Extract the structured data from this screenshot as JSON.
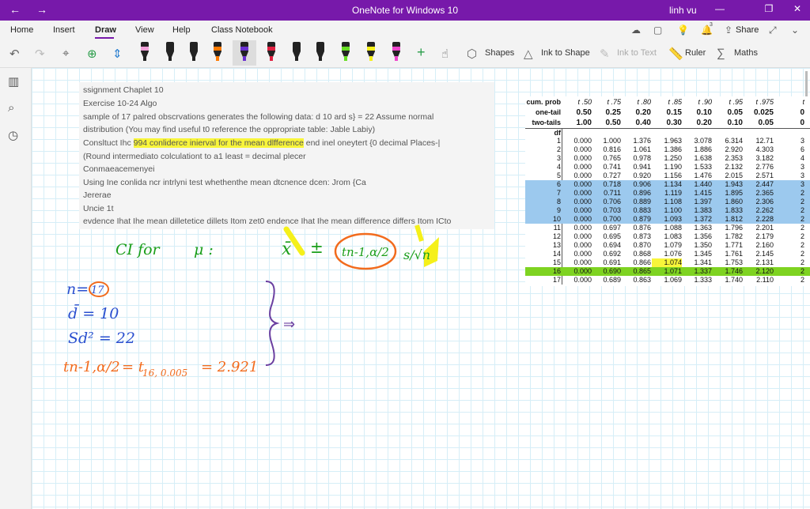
{
  "window": {
    "title": "OneNote for Windows 10",
    "user": "linh vu"
  },
  "ribbon": {
    "tabs": [
      "Home",
      "Insert",
      "Draw",
      "View",
      "Help",
      "Class Notebook"
    ],
    "active_tab": "Draw",
    "notification_count": "3",
    "share_label": "Share"
  },
  "toolbar": {
    "shapes_label": "Shapes",
    "ink_to_shape_label": "Ink to Shape",
    "ink_to_text_label": "Ink to Text",
    "ruler_label": "Ruler",
    "maths_label": "Maths",
    "pens": [
      {
        "name": "pen-purple-band",
        "band": "#f0a0d8",
        "tip": "#222"
      },
      {
        "name": "pen-black-1",
        "band": "#222",
        "tip": "#222"
      },
      {
        "name": "pen-black-2",
        "band": "#222",
        "tip": "#222"
      },
      {
        "name": "pen-orange",
        "band": "#ff7a00",
        "tip": "#ff7a00"
      },
      {
        "name": "pen-purple",
        "band": "#6a2fd0",
        "tip": "#6a2fd0"
      },
      {
        "name": "pen-red",
        "band": "#e02040",
        "tip": "#e02040"
      },
      {
        "name": "pen-black-3",
        "band": "#222",
        "tip": "#222"
      },
      {
        "name": "pen-black-4",
        "band": "#222",
        "tip": "#222"
      },
      {
        "name": "highlighter-green",
        "band": "#66dd22",
        "tip": "#66dd22"
      },
      {
        "name": "highlighter-yellow",
        "band": "#f5f01a",
        "tip": "#f5f01a"
      },
      {
        "name": "highlighter-pink",
        "band": "#ee44cc",
        "tip": "#ee44cc"
      }
    ]
  },
  "question": {
    "lines": [
      "ssignment Chaplet 10",
      "Exercise 10-24 Algo",
      "sample of 17 palred obscrvations generates the following data: d 10 ard s} = 22 Assume normal",
      "distribution (You may find useful t0 reference the oppropriate table: Jable Labiy)",
      "",
      "(Round intermediato colculationt to a1 least = decimal plecer",
      "Conmaeacemenyei",
      "Using Ine conlida ncr intrlyni test whethenthe mean dtcnence dcen: Jrom {Ca",
      "Jererae",
      "Uncie 1t",
      "evdence Ihat Ihe mean dilletetice dillets Itom zet0 endence Ihat Ihe mean difference differs Itom ICto"
    ],
    "line5_pre": "Consltuct Ihc ",
    "line5_highlight": "994 conliderce inierval for the mean dlfference",
    "line5_post": " end inel oneytert {0 decimal Places-|"
  },
  "t_table": {
    "header_labels": [
      "cum. prob",
      "one-tail",
      "two-tails",
      "df"
    ],
    "t_labels": [
      "t .50",
      "t .75",
      "t .80",
      "t .85",
      "t .90",
      "t .95",
      "t .975",
      "t"
    ],
    "one_tail": [
      "0.50",
      "0.25",
      "0.20",
      "0.15",
      "0.10",
      "0.05",
      "0.025",
      "0"
    ],
    "two_tails": [
      "1.00",
      "0.50",
      "0.40",
      "0.30",
      "0.20",
      "0.10",
      "0.05",
      "0"
    ],
    "rows": [
      {
        "df": "1",
        "v": [
          "0.000",
          "1.000",
          "1.376",
          "1.963",
          "3.078",
          "6.314",
          "12.71",
          "3"
        ]
      },
      {
        "df": "2",
        "v": [
          "0.000",
          "0.816",
          "1.061",
          "1.386",
          "1.886",
          "2.920",
          "4.303",
          "6"
        ]
      },
      {
        "df": "3",
        "v": [
          "0.000",
          "0.765",
          "0.978",
          "1.250",
          "1.638",
          "2.353",
          "3.182",
          "4"
        ]
      },
      {
        "df": "4",
        "v": [
          "0.000",
          "0.741",
          "0.941",
          "1.190",
          "1.533",
          "2.132",
          "2.776",
          "3"
        ]
      },
      {
        "df": "5",
        "v": [
          "0.000",
          "0.727",
          "0.920",
          "1.156",
          "1.476",
          "2.015",
          "2.571",
          "3"
        ]
      },
      {
        "df": "6",
        "v": [
          "0.000",
          "0.718",
          "0.906",
          "1.134",
          "1.440",
          "1.943",
          "2.447",
          "3"
        ]
      },
      {
        "df": "7",
        "v": [
          "0.000",
          "0.711",
          "0.896",
          "1.119",
          "1.415",
          "1.895",
          "2.365",
          "2"
        ]
      },
      {
        "df": "8",
        "v": [
          "0.000",
          "0.706",
          "0.889",
          "1.108",
          "1.397",
          "1.860",
          "2.306",
          "2"
        ]
      },
      {
        "df": "9",
        "v": [
          "0.000",
          "0.703",
          "0.883",
          "1.100",
          "1.383",
          "1.833",
          "2.262",
          "2"
        ]
      },
      {
        "df": "10",
        "v": [
          "0.000",
          "0.700",
          "0.879",
          "1.093",
          "1.372",
          "1.812",
          "2.228",
          "2"
        ]
      },
      {
        "df": "11",
        "v": [
          "0.000",
          "0.697",
          "0.876",
          "1.088",
          "1.363",
          "1.796",
          "2.201",
          "2"
        ]
      },
      {
        "df": "12",
        "v": [
          "0.000",
          "0.695",
          "0.873",
          "1.083",
          "1.356",
          "1.782",
          "2.179",
          "2"
        ]
      },
      {
        "df": "13",
        "v": [
          "0.000",
          "0.694",
          "0.870",
          "1.079",
          "1.350",
          "1.771",
          "2.160",
          "2"
        ]
      },
      {
        "df": "14",
        "v": [
          "0.000",
          "0.692",
          "0.868",
          "1.076",
          "1.345",
          "1.761",
          "2.145",
          "2"
        ]
      },
      {
        "df": "15",
        "v": [
          "0.000",
          "0.691",
          "0.866",
          "1.074",
          "1.341",
          "1.753",
          "2.131",
          "2"
        ]
      },
      {
        "df": "16",
        "v": [
          "0.000",
          "0.690",
          "0.865",
          "1.071",
          "1.337",
          "1.746",
          "2.120",
          "2"
        ]
      },
      {
        "df": "17",
        "v": [
          "0.000",
          "0.689",
          "0.863",
          "1.069",
          "1.333",
          "1.740",
          "2.110",
          "2"
        ]
      }
    ],
    "blue_rows": [
      "6",
      "7",
      "8",
      "9",
      "10",
      "16"
    ],
    "highlight_green_row": "16",
    "highlight_yellow_cell": {
      "row": "15",
      "col": 3
    },
    "colors": {
      "blue_band": "#9cc9ee",
      "green_band": "#7ed321",
      "yellow": "#f8f53a"
    }
  },
  "ink": {
    "ci_text": "CI for",
    "mu_text": "μ :",
    "xbar": "x̄",
    "pm": "±",
    "t_sub": "tn-1,α/2",
    "s_over_root_n": "s/√n",
    "n_eq": "n=",
    "n_val": "17",
    "dbar_eq": "d̄ = 10",
    "sd2_eq": "Sd² = 22",
    "t_eq_lhs": "tn-1,α/2",
    "t_eq_mid": "= t",
    "t_eq_sub": "16, 0.005",
    "t_eq_rhs": "= 2.921",
    "arrow": "⇒",
    "colors": {
      "green": "#1a9e1a",
      "blue": "#2a4fcf",
      "orange": "#f26b1d",
      "purple": "#6b3fa0",
      "yellow": "#f5f01a"
    }
  }
}
